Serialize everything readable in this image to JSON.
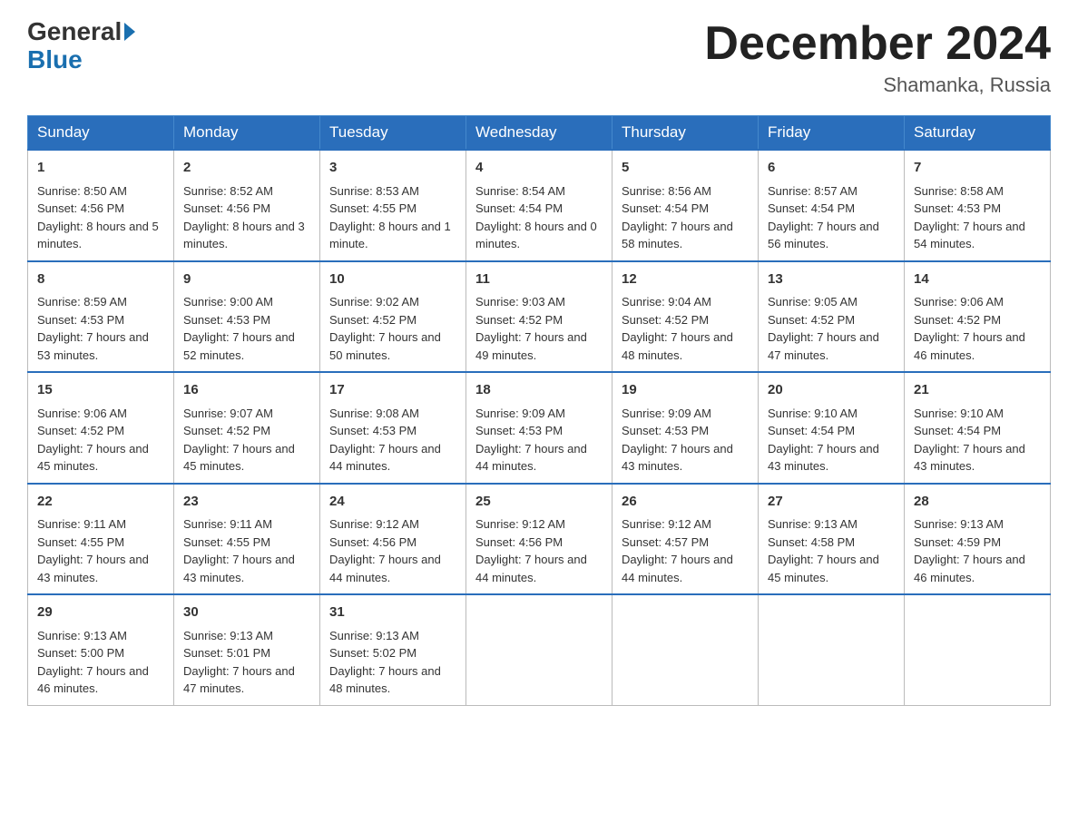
{
  "header": {
    "logo_text1": "General",
    "logo_text2": "Blue",
    "month_title": "December 2024",
    "subtitle": "Shamanka, Russia"
  },
  "days_of_week": [
    "Sunday",
    "Monday",
    "Tuesday",
    "Wednesday",
    "Thursday",
    "Friday",
    "Saturday"
  ],
  "weeks": [
    [
      {
        "day": "1",
        "sunrise": "8:50 AM",
        "sunset": "4:56 PM",
        "daylight": "8 hours and 5 minutes."
      },
      {
        "day": "2",
        "sunrise": "8:52 AM",
        "sunset": "4:56 PM",
        "daylight": "8 hours and 3 minutes."
      },
      {
        "day": "3",
        "sunrise": "8:53 AM",
        "sunset": "4:55 PM",
        "daylight": "8 hours and 1 minute."
      },
      {
        "day": "4",
        "sunrise": "8:54 AM",
        "sunset": "4:54 PM",
        "daylight": "8 hours and 0 minutes."
      },
      {
        "day": "5",
        "sunrise": "8:56 AM",
        "sunset": "4:54 PM",
        "daylight": "7 hours and 58 minutes."
      },
      {
        "day": "6",
        "sunrise": "8:57 AM",
        "sunset": "4:54 PM",
        "daylight": "7 hours and 56 minutes."
      },
      {
        "day": "7",
        "sunrise": "8:58 AM",
        "sunset": "4:53 PM",
        "daylight": "7 hours and 54 minutes."
      }
    ],
    [
      {
        "day": "8",
        "sunrise": "8:59 AM",
        "sunset": "4:53 PM",
        "daylight": "7 hours and 53 minutes."
      },
      {
        "day": "9",
        "sunrise": "9:00 AM",
        "sunset": "4:53 PM",
        "daylight": "7 hours and 52 minutes."
      },
      {
        "day": "10",
        "sunrise": "9:02 AM",
        "sunset": "4:52 PM",
        "daylight": "7 hours and 50 minutes."
      },
      {
        "day": "11",
        "sunrise": "9:03 AM",
        "sunset": "4:52 PM",
        "daylight": "7 hours and 49 minutes."
      },
      {
        "day": "12",
        "sunrise": "9:04 AM",
        "sunset": "4:52 PM",
        "daylight": "7 hours and 48 minutes."
      },
      {
        "day": "13",
        "sunrise": "9:05 AM",
        "sunset": "4:52 PM",
        "daylight": "7 hours and 47 minutes."
      },
      {
        "day": "14",
        "sunrise": "9:06 AM",
        "sunset": "4:52 PM",
        "daylight": "7 hours and 46 minutes."
      }
    ],
    [
      {
        "day": "15",
        "sunrise": "9:06 AM",
        "sunset": "4:52 PM",
        "daylight": "7 hours and 45 minutes."
      },
      {
        "day": "16",
        "sunrise": "9:07 AM",
        "sunset": "4:52 PM",
        "daylight": "7 hours and 45 minutes."
      },
      {
        "day": "17",
        "sunrise": "9:08 AM",
        "sunset": "4:53 PM",
        "daylight": "7 hours and 44 minutes."
      },
      {
        "day": "18",
        "sunrise": "9:09 AM",
        "sunset": "4:53 PM",
        "daylight": "7 hours and 44 minutes."
      },
      {
        "day": "19",
        "sunrise": "9:09 AM",
        "sunset": "4:53 PM",
        "daylight": "7 hours and 43 minutes."
      },
      {
        "day": "20",
        "sunrise": "9:10 AM",
        "sunset": "4:54 PM",
        "daylight": "7 hours and 43 minutes."
      },
      {
        "day": "21",
        "sunrise": "9:10 AM",
        "sunset": "4:54 PM",
        "daylight": "7 hours and 43 minutes."
      }
    ],
    [
      {
        "day": "22",
        "sunrise": "9:11 AM",
        "sunset": "4:55 PM",
        "daylight": "7 hours and 43 minutes."
      },
      {
        "day": "23",
        "sunrise": "9:11 AM",
        "sunset": "4:55 PM",
        "daylight": "7 hours and 43 minutes."
      },
      {
        "day": "24",
        "sunrise": "9:12 AM",
        "sunset": "4:56 PM",
        "daylight": "7 hours and 44 minutes."
      },
      {
        "day": "25",
        "sunrise": "9:12 AM",
        "sunset": "4:56 PM",
        "daylight": "7 hours and 44 minutes."
      },
      {
        "day": "26",
        "sunrise": "9:12 AM",
        "sunset": "4:57 PM",
        "daylight": "7 hours and 44 minutes."
      },
      {
        "day": "27",
        "sunrise": "9:13 AM",
        "sunset": "4:58 PM",
        "daylight": "7 hours and 45 minutes."
      },
      {
        "day": "28",
        "sunrise": "9:13 AM",
        "sunset": "4:59 PM",
        "daylight": "7 hours and 46 minutes."
      }
    ],
    [
      {
        "day": "29",
        "sunrise": "9:13 AM",
        "sunset": "5:00 PM",
        "daylight": "7 hours and 46 minutes."
      },
      {
        "day": "30",
        "sunrise": "9:13 AM",
        "sunset": "5:01 PM",
        "daylight": "7 hours and 47 minutes."
      },
      {
        "day": "31",
        "sunrise": "9:13 AM",
        "sunset": "5:02 PM",
        "daylight": "7 hours and 48 minutes."
      },
      null,
      null,
      null,
      null
    ]
  ]
}
